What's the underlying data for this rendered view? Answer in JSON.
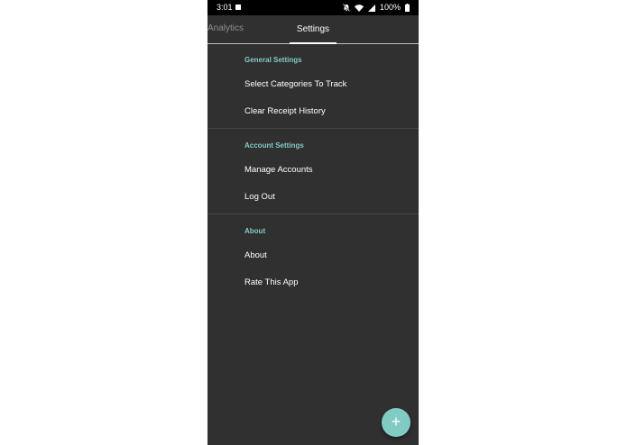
{
  "status_bar": {
    "time": "3:01",
    "battery": "100%",
    "icons": [
      "image-icon",
      "mute-icon",
      "wifi-icon",
      "signal-icon",
      "battery-icon"
    ]
  },
  "tabs": [
    {
      "label": "Analytics",
      "selected": false
    },
    {
      "label": "Settings",
      "selected": true
    }
  ],
  "sections": [
    {
      "header": "General Settings",
      "items": [
        "Select Categories To Track",
        "Clear Receipt History"
      ]
    },
    {
      "header": "Account Settings",
      "items": [
        "Manage Accounts",
        "Log Out"
      ]
    },
    {
      "header": "About",
      "items": [
        "About",
        "Rate This App"
      ]
    }
  ],
  "fab": {
    "icon": "plus-icon"
  },
  "colors": {
    "accent": "#80cbc4",
    "background": "#303030",
    "status_bar": "#000000",
    "text": "#ffffff"
  }
}
